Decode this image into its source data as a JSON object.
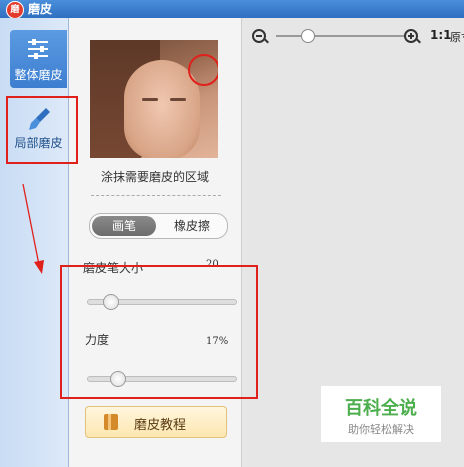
{
  "window": {
    "title": "磨皮",
    "app_icon_text": "磨"
  },
  "nav": {
    "items": [
      {
        "label": "整体磨皮",
        "icon": "sliders-icon",
        "active": true
      },
      {
        "label": "局部磨皮",
        "icon": "brush-icon",
        "active": false
      }
    ]
  },
  "panel": {
    "hint": "涂抹需要磨皮的区域",
    "mode": {
      "active": "画笔",
      "inactive": "橡皮擦"
    },
    "brush_size": {
      "label": "磨皮笔大小",
      "value": "20",
      "level": 0.12
    },
    "strength": {
      "label": "力度",
      "value": "17%",
      "level": 0.17
    },
    "tutorial_label": "磨皮教程"
  },
  "preview": {
    "zoom_ratio": "1:1",
    "zoom_ratio_text": "原寸",
    "zoom_level": 0.21
  },
  "watermark": {
    "main": "百科全说",
    "sub": "助你轻松解决"
  },
  "colors": {
    "annotation": "#e0211b",
    "accent": "#3d7ed0"
  }
}
